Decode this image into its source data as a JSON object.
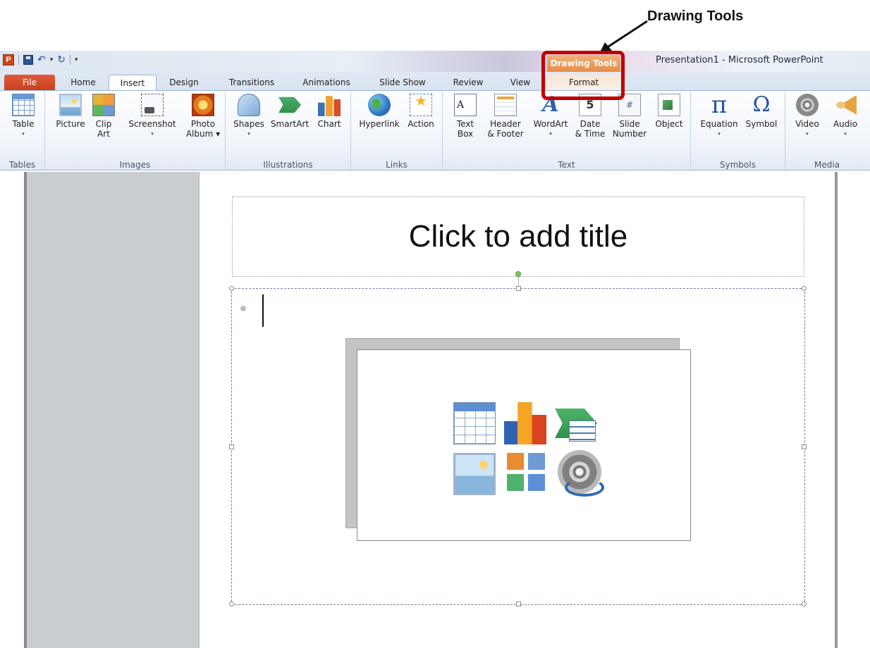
{
  "annotation": {
    "label": "Drawing Tools"
  },
  "window": {
    "title": "Presentation1  -  Microsoft PowerPoint"
  },
  "qat": {
    "app_icon": "P"
  },
  "contextual_tab": {
    "group_label": "Drawing Tools",
    "tab_label": "Format"
  },
  "tabs": [
    "File",
    "Home",
    "Insert",
    "Design",
    "Transitions",
    "Animations",
    "Slide Show",
    "Review",
    "View"
  ],
  "active_tab": "Insert",
  "ribbon": {
    "groups": {
      "tables": "Tables",
      "images": "Images",
      "illustrations": "Illustrations",
      "links": "Links",
      "text": "Text",
      "symbols": "Symbols",
      "media": "Media"
    },
    "buttons": {
      "table": "Table",
      "picture": "Picture",
      "clip_art": "Clip\nArt",
      "screenshot": "Screenshot",
      "photo_album": "Photo\nAlbum ▾",
      "shapes": "Shapes",
      "smartart": "SmartArt",
      "chart": "Chart",
      "hyperlink": "Hyperlink",
      "action": "Action",
      "text_box": "Text\nBox",
      "header_footer": "Header\n& Footer",
      "wordart": "WordArt",
      "date_time": "Date\n& Time",
      "slide_number": "Slide\nNumber",
      "object": "Object",
      "equation": "Equation",
      "symbol": "Symbol",
      "video": "Video",
      "audio": "Audio"
    },
    "icon_glyphs": {
      "text_box": "A",
      "wordart": "A",
      "date_time": "5",
      "slide_number": "#",
      "equation": "π",
      "symbol": "Ω"
    },
    "dropdown_marker": "▾"
  },
  "slide": {
    "title_placeholder": "Click to add title"
  }
}
